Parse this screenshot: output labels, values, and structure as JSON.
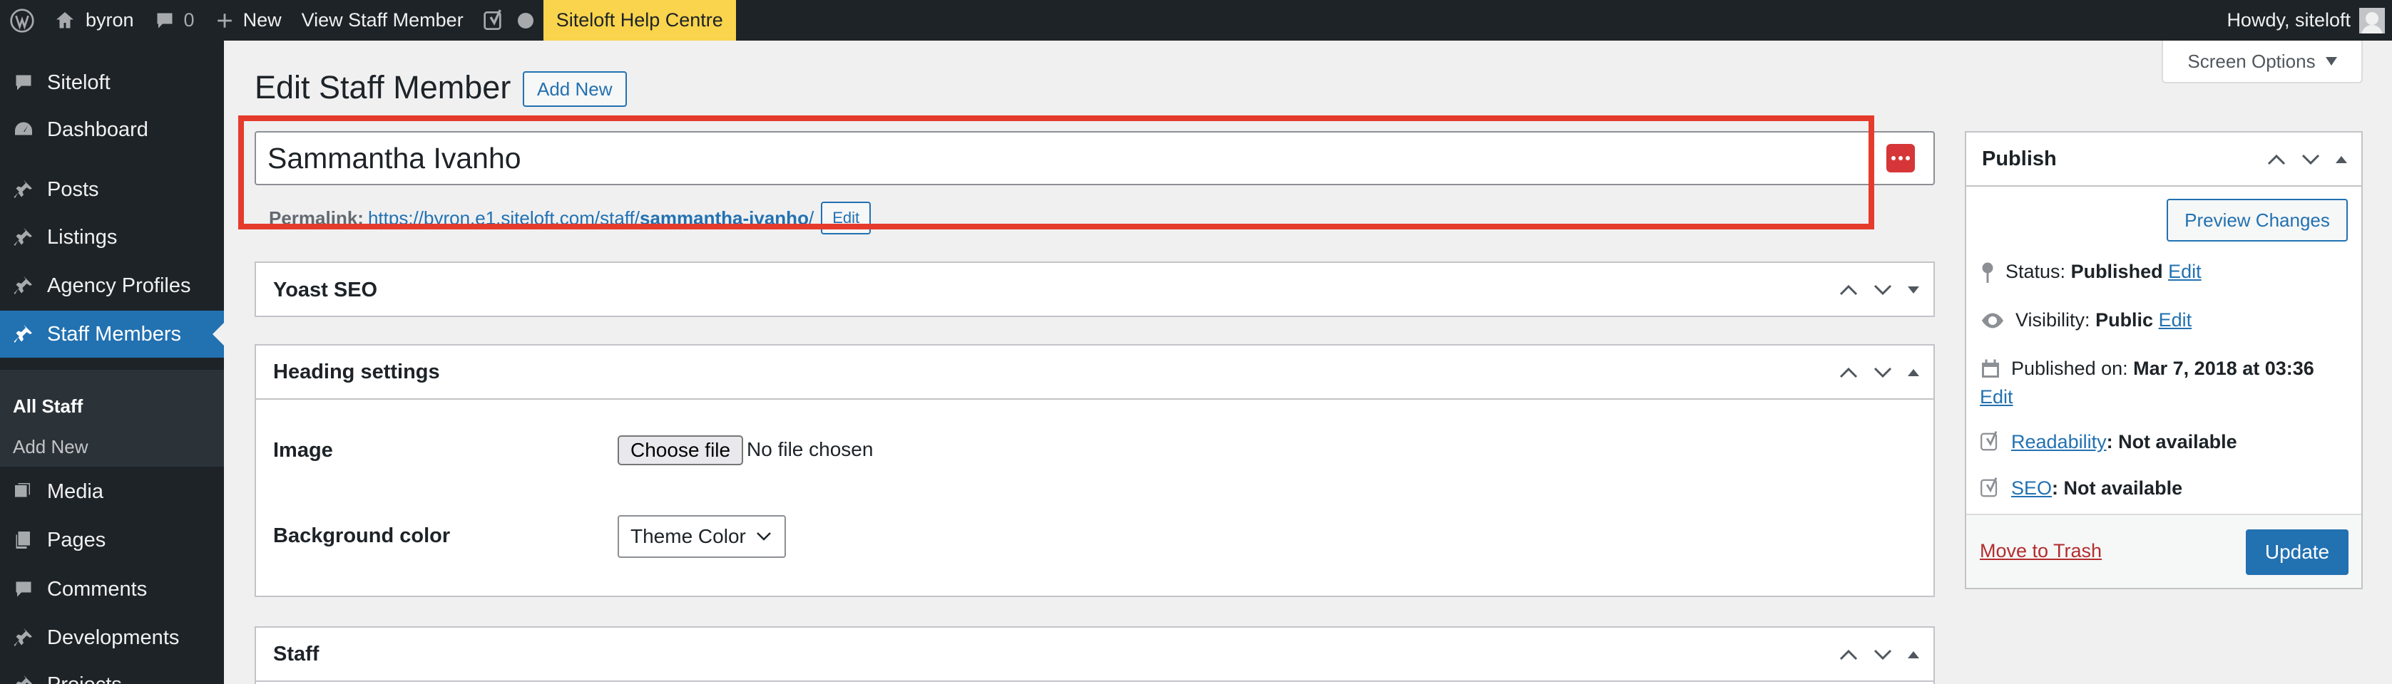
{
  "adminbar": {
    "site_name": "byron",
    "comments_count": "0",
    "new_label": "New",
    "view_label": "View Staff Member",
    "help_label": "Siteloft Help Centre",
    "howdy": "Howdy, siteloft"
  },
  "sidebar": {
    "items": [
      {
        "label": "Siteloft",
        "icon": "speech-bubble-icon"
      },
      {
        "label": "Dashboard",
        "icon": "dashboard-icon"
      },
      {
        "label": "Posts",
        "icon": "pin-icon"
      },
      {
        "label": "Listings",
        "icon": "pin-icon"
      },
      {
        "label": "Agency Profiles",
        "icon": "pin-icon"
      },
      {
        "label": "Staff Members",
        "icon": "pin-icon"
      },
      {
        "label": "Media",
        "icon": "media-icon"
      },
      {
        "label": "Pages",
        "icon": "pages-icon"
      },
      {
        "label": "Comments",
        "icon": "comment-icon"
      },
      {
        "label": "Developments",
        "icon": "pin-icon"
      },
      {
        "label": "Projects",
        "icon": "pin-icon"
      }
    ],
    "submenu": [
      "All Staff",
      "Add New"
    ]
  },
  "header": {
    "title": "Edit Staff Member",
    "add_new": "Add New",
    "screen_options": "Screen Options"
  },
  "post": {
    "title": "Sammantha Ivanho",
    "permalink_label": "Permalink:",
    "permalink_base": "https://byron.e1.siteloft.com/staff/",
    "permalink_slug": "sammantha-ivanho",
    "permalink_trail": "/",
    "permalink_edit": "Edit"
  },
  "boxes": {
    "yoast": "Yoast SEO",
    "heading": "Heading settings",
    "image_label": "Image",
    "choose_file": "Choose file",
    "no_file": "No file chosen",
    "bg_label": "Background color",
    "bg_value": "Theme Color",
    "staff": "Staff"
  },
  "publish": {
    "title": "Publish",
    "preview": "Preview Changes",
    "status_label": "Status:",
    "status_value": "Published",
    "visibility_label": "Visibility:",
    "visibility_value": "Public",
    "published_label": "Published on:",
    "published_value": "Mar 7, 2018 at 03:36",
    "edit": "Edit",
    "readability_link": "Readability",
    "readability_value": ": Not available",
    "seo_link": "SEO",
    "seo_value": ": Not available",
    "trash": "Move to Trash",
    "update": "Update"
  },
  "colors": {
    "adminbar": "#1d2327",
    "accent": "#2271b1",
    "help_bg": "#f9d44c",
    "highlight": "#e53b2c",
    "trash": "#b32d2e"
  }
}
